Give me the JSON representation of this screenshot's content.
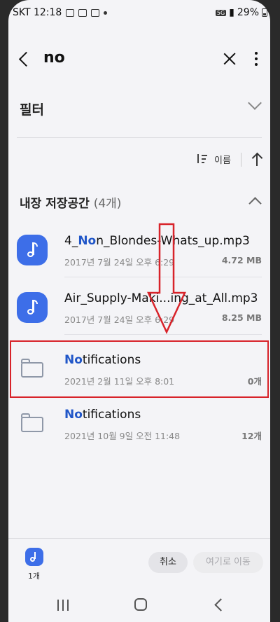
{
  "status": {
    "carrier_time": "SKT 12:18",
    "network": "5G",
    "battery": "29%"
  },
  "search": {
    "query": "no"
  },
  "filter": {
    "label": "필터"
  },
  "sort": {
    "label": "이름"
  },
  "section": {
    "title": "내장 저장공간",
    "count": "(4개)"
  },
  "files": [
    {
      "name_pre": "4_",
      "name_hl": "No",
      "name_post": "n_Blondes-Whats_up.mp3",
      "date": "2017년 7월 24일 오후 6:29",
      "size": "4.72 MB",
      "type": "audio"
    },
    {
      "name_pre": "",
      "name_hl": "",
      "name_post": "Air_Supply-Maki...ing_at_All.mp3",
      "date": "2017년 7월 24일 오후 6:29",
      "size": "8.25 MB",
      "type": "audio"
    },
    {
      "name_pre": "",
      "name_hl": "No",
      "name_post": "tifications",
      "date": "2021년 2월 11일 오후 8:01",
      "size": "0개",
      "type": "folder"
    },
    {
      "name_pre": "",
      "name_hl": "No",
      "name_post": "tifications",
      "date": "2021년 10월 9일 오전 11:48",
      "size": "12개",
      "type": "folder"
    }
  ],
  "selection": {
    "count": "1개"
  },
  "actions": {
    "cancel": "취소",
    "move_here": "여기로 이동"
  },
  "colors": {
    "accent": "#2056c8",
    "annotation_red": "#d8232a"
  }
}
